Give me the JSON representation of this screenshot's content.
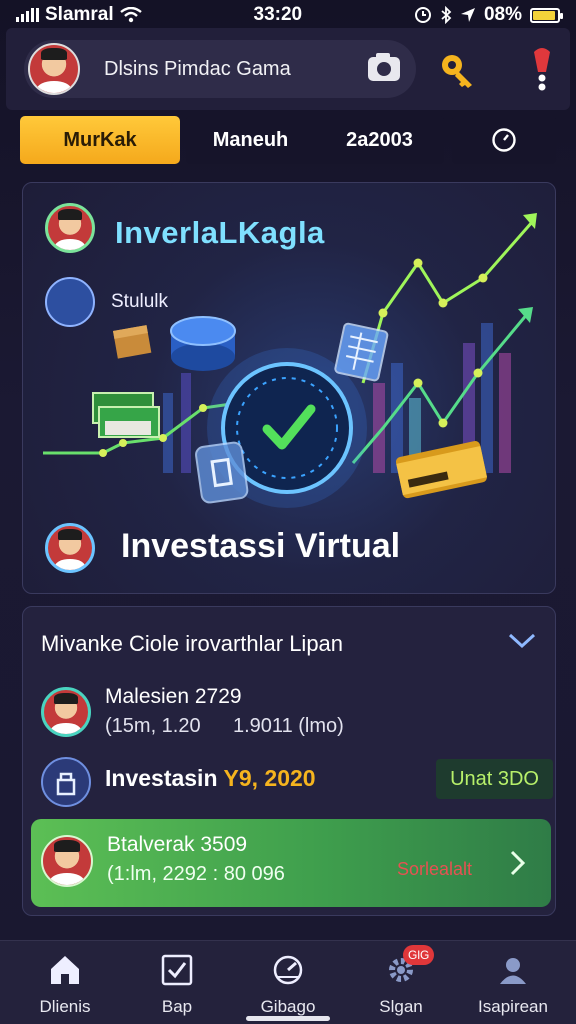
{
  "status_bar": {
    "carrier": "Slamral",
    "time": "33:20",
    "battery_text": "08%",
    "battery_level": 0.92
  },
  "header": {
    "profile_name": "Dlsins Pimdac Gama"
  },
  "tabs": {
    "active": "MurKak",
    "middle_left": "Maneuh",
    "middle_right": "2a2003"
  },
  "hero": {
    "title": "InverlaLKagla",
    "subtitle": "Stululk",
    "main_title": "Investassi Virtual"
  },
  "list_card": {
    "title": "Mivanke Ciole irovarthlar Lipan",
    "rows": [
      {
        "title": "Malesien 2729",
        "sub_left": "(15m, 1.20",
        "sub_right": "1.9011 (lmo)"
      },
      {
        "title_prefix": "Investasin ",
        "title_highlight": "Y9, 2020",
        "badge": "Unat 3DO"
      },
      {
        "title": "Btalverak 3509",
        "sub_left": "(1:lm, 2292 : 80 096",
        "status": "Sorlealalt"
      }
    ]
  },
  "bottom_nav": [
    {
      "label": "Dlienis",
      "icon": "home-icon"
    },
    {
      "label": "Bap",
      "icon": "checkbox-icon"
    },
    {
      "label": "Gibago",
      "icon": "speedometer-icon"
    },
    {
      "label": "Slgan",
      "icon": "gear-icon",
      "badge": "GlG"
    },
    {
      "label": "Isapirean",
      "icon": "profile-icon"
    }
  ],
  "colors": {
    "accent_gold": "#f5a91c",
    "hero_title": "#7fe0ff",
    "highlight_green": "#4fb052",
    "badge_text": "#b7f06a",
    "status_red": "#e65252"
  }
}
